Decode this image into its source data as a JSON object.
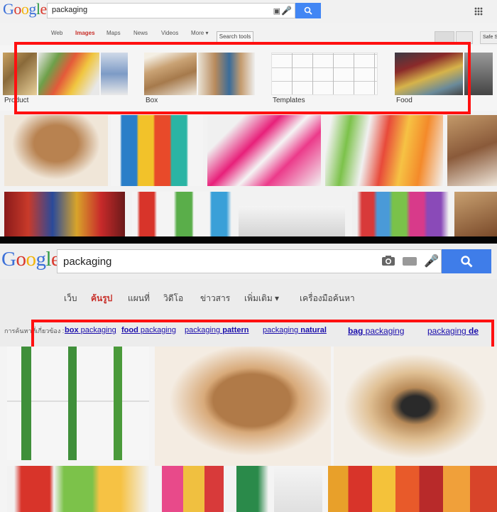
{
  "top": {
    "logo": [
      {
        "ch": "G",
        "color": "#3c70d8"
      },
      {
        "ch": "o",
        "color": "#d9382c"
      },
      {
        "ch": "o",
        "color": "#f2b40a"
      },
      {
        "ch": "g",
        "color": "#3c70d8"
      },
      {
        "ch": "l",
        "color": "#2f9a45"
      },
      {
        "ch": "e",
        "color": "#d9382c"
      }
    ],
    "search": {
      "query": "packaging",
      "camera_icon": "camera-icon",
      "mic_icon": "mic-icon",
      "button_icon": "search-icon"
    },
    "tabs": [
      "Web",
      "Images",
      "Maps",
      "News",
      "Videos",
      "More ▾"
    ],
    "search_tools": "Search tools",
    "safe_search": "Safe S",
    "categories": [
      "Product",
      "Box",
      "Templates",
      "Food"
    ]
  },
  "bottom": {
    "logo": [
      {
        "ch": "G",
        "color": "#3c70d8"
      },
      {
        "ch": "o",
        "color": "#d9382c"
      },
      {
        "ch": "o",
        "color": "#f2b40a"
      },
      {
        "ch": "g",
        "color": "#3c70d8"
      },
      {
        "ch": "l",
        "color": "#2f9a45"
      },
      {
        "ch": "e",
        "color": "#d9382c"
      }
    ],
    "search": {
      "query": "packaging",
      "camera_icon": "camera-icon",
      "keyboard_icon": "keyboard-icon",
      "mic_icon": "mic-icon",
      "button_icon": "search-icon"
    },
    "tabs": [
      "เว็บ",
      "ค้นรูป",
      "แผนที่",
      "วิดีโอ",
      "ข่าวสาร",
      "เพิ่มเติม ▾",
      "เครื่องมือค้นหา"
    ],
    "related_prefix": "การค้นหาที่เกี่ยวข้อง :",
    "related": [
      {
        "bold": "box",
        "rest": " packaging"
      },
      {
        "bold": "food",
        "rest": " packaging"
      },
      {
        "pre": "packaging ",
        "bold": "pattern"
      },
      {
        "pre": "packaging ",
        "bold": "natural"
      },
      {
        "bold": "bag",
        "rest": " packaging"
      },
      {
        "pre": "packaging ",
        "bold": "de"
      }
    ]
  },
  "colors": {
    "highlight": "#ff1010",
    "search_blue": "#4286f4",
    "active_tab": "#c8302a",
    "link": "#1a0dab"
  }
}
